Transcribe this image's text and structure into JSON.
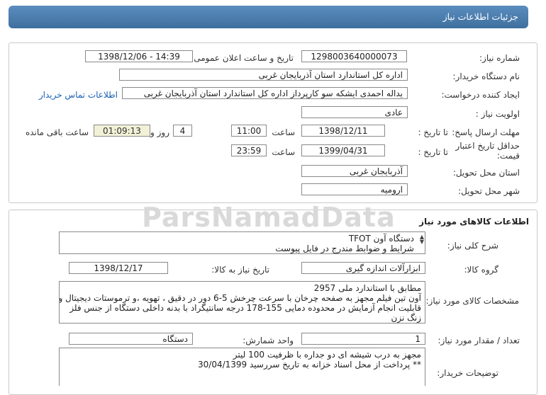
{
  "header": {
    "title": "جزئیات اطلاعات نیاز"
  },
  "info": {
    "need_number_label": "شماره نیاز:",
    "need_number": "1298003640000073",
    "announce_label": "تاریخ و ساعت اعلان عمومی:",
    "announce_value": "1398/12/06 - 14:39",
    "buyer_label": "نام دستگاه خریدار:",
    "buyer_value": "اداره کل استاندارد استان آذربایجان غربی",
    "creator_label": "ایجاد کننده درخواست:",
    "creator_value": "یداله  احمدی ایشکه سو کارپرداز اداره کل استاندارد استان آذربایجان غربی",
    "contact_link": "اطلاعات تماس خریدار",
    "priority_label": "اولویت نیاز :",
    "priority_value": "عادی",
    "deadline_label": "مهلت ارسال پاسخ:",
    "to_date_label": "تا تاریخ :",
    "deadline_date": "1398/12/11",
    "time_label": "ساعت",
    "deadline_time": "11:00",
    "days_value": "4",
    "days_label": "روز و",
    "remaining_value": "01:09:13",
    "remaining_label": "ساعت باقی مانده",
    "validity_label": "حداقل تاریخ اعتبار قیمت:",
    "validity_date": "1399/04/31",
    "validity_time": "23:59",
    "province_label": "استان محل تحویل:",
    "province_value": "آذربایجان غربی",
    "city_label": "شهر محل تحویل:",
    "city_value": "ارومیه"
  },
  "goods": {
    "title": "اطلاعات کالاهای مورد نیاز",
    "desc_label": "شرح کلی نیاز:",
    "desc_line1": "دستگاه آون  TFOT",
    "desc_line2": "شرایط و ضوابط مندرج در فایل پیوست",
    "group_label": "گروه کالا:",
    "group_value": "ابزارآلات اندازه گیری",
    "need_date_label": "تاریخ نیاز به کالا:",
    "need_date_value": "1398/12/17",
    "spec_label": "مشخصات کالای مورد نیاز:",
    "spec_line1": "مطابق با استاندارد ملی 2957",
    "spec_line2": "آون تین فیلم مجهز به صفحه چرخان با سرعت چرخش 5-6 دور در دقیق ، تهویه ،و ترموستات دیجیتال و",
    "spec_line3": "قابلیت انجام آزمایش در محدوده دمایی 155-178 درجه سانتیگراد با بدنه داخلی دستگاه از جنس فلز",
    "spec_line4": "زنگ نزن",
    "qty_label": "تعداد / مقدار مورد نیاز:",
    "qty_value": "1",
    "unit_label": "واحد شمارش:",
    "unit_value": "دستگاه",
    "buyer_notes_label": "توضیحات خریدار:",
    "notes_line1": "مجهز به درب شیشه ای  دو جداره با ظرفیت 100 لیتر",
    "notes_line2": "** پرداخت از محل اسناد خزانه به تاریخ سررسید 30/04/1399"
  },
  "watermark": {
    "text": "ParsNamadData"
  }
}
